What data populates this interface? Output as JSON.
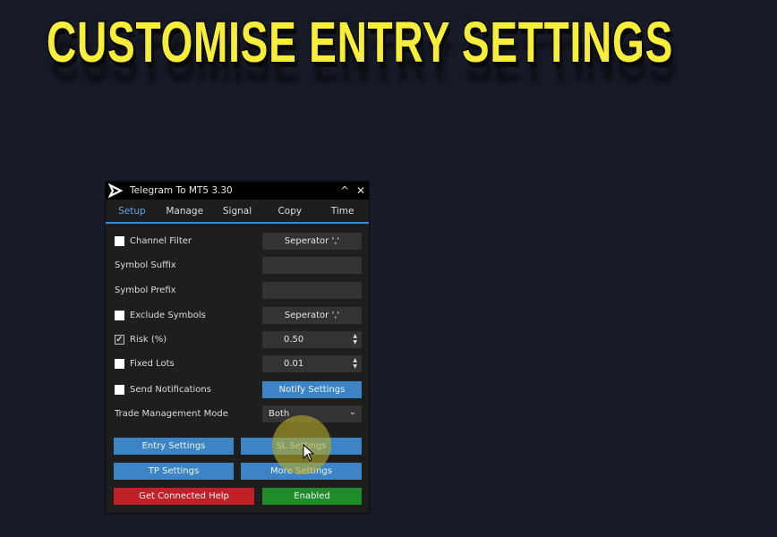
{
  "headline": "CUSTOMISE ENTRY SETTINGS",
  "window": {
    "title": "Telegram To MT5 3.30",
    "logo_icon": "play-arrow-logo-icon",
    "controls": {
      "collapse": "^",
      "close": "✕"
    }
  },
  "tabs": [
    {
      "label": "Setup",
      "active": true
    },
    {
      "label": "Manage",
      "active": false
    },
    {
      "label": "Signal",
      "active": false
    },
    {
      "label": "Copy",
      "active": false
    },
    {
      "label": "Time",
      "active": false
    }
  ],
  "setup": {
    "channel_filter": {
      "label": "Channel Filter",
      "checked": false,
      "button": "Seperator ','"
    },
    "symbol_suffix": {
      "label": "Symbol Suffix",
      "value": ""
    },
    "symbol_prefix": {
      "label": "Symbol Prefix",
      "value": ""
    },
    "exclude_symbols": {
      "label": "Exclude Symbols",
      "checked": false,
      "button": "Seperator ','"
    },
    "risk": {
      "label": "Risk (%)",
      "checked": true,
      "value": "0.50"
    },
    "fixed_lots": {
      "label": "Fixed Lots",
      "checked": false,
      "value": "0.01"
    },
    "send_notifications": {
      "label": "Send Notifications",
      "checked": false,
      "button": "Notify Settings"
    },
    "trade_management_mode": {
      "label": "Trade Management Mode",
      "selected": "Both"
    }
  },
  "buttons": {
    "entry_settings": "Entry Settings",
    "sl_settings": "SL Settings",
    "tp_settings": "TP Settings",
    "more_settings": "More Settings",
    "get_connected_help": "Get Connected Help",
    "enabled": "Enabled"
  },
  "colors": {
    "accent_blue": "#3c84c5",
    "danger_red": "#c02127",
    "success_green": "#1f8c2a",
    "headline_yellow": "#f7ee3c"
  }
}
